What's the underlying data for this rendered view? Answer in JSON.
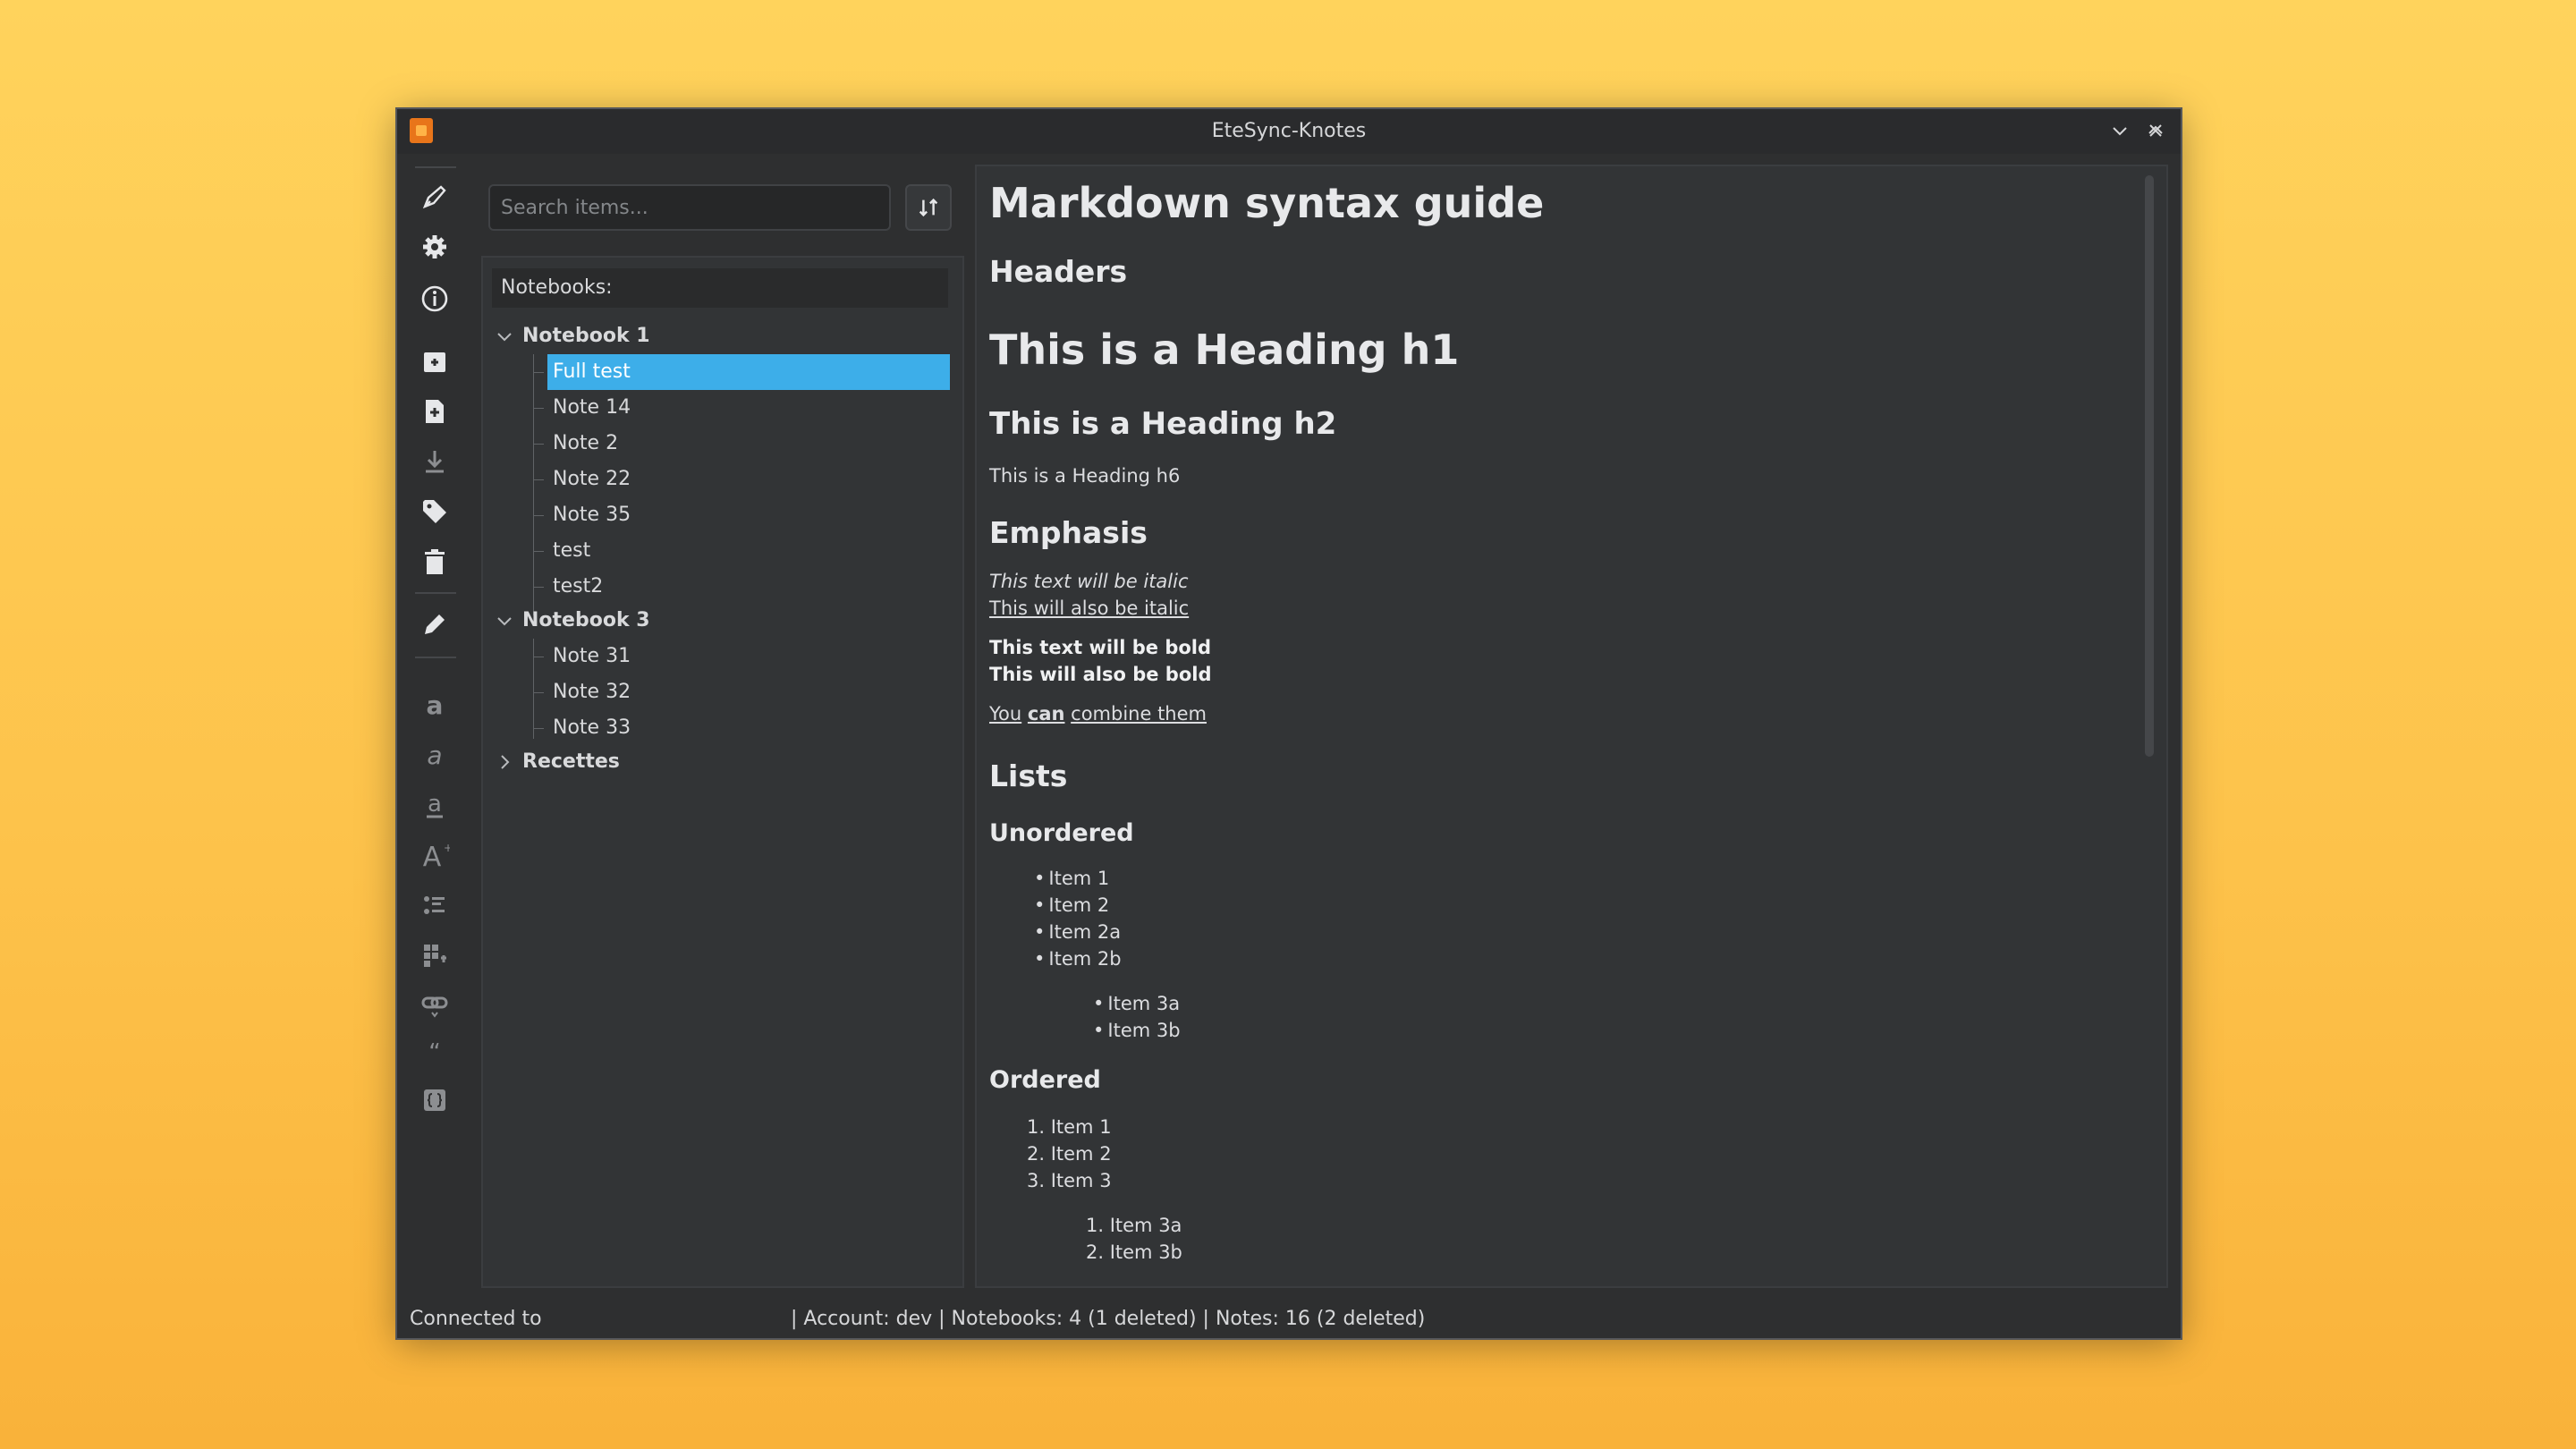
{
  "window": {
    "title": "EteSync-Knotes"
  },
  "search": {
    "placeholder": "Search items..."
  },
  "tree": {
    "header": "Notebooks:",
    "notebooks": [
      {
        "label": "Notebook 1",
        "notes": [
          "Full test",
          "Note 14",
          "Note 2",
          "Note 22",
          "Note 35",
          "test",
          "test2"
        ]
      },
      {
        "label": "Notebook 3",
        "notes": [
          "Note 31",
          "Note 32",
          "Note 33"
        ]
      },
      {
        "label": "Recettes"
      }
    ],
    "selected_note": "Full test"
  },
  "doc": {
    "title": "Markdown syntax guide",
    "headers": "Headers",
    "h1": "This is a Heading h1",
    "h2": "This is a Heading h2",
    "h6": "This is a Heading h6",
    "emphasis": "Emphasis",
    "italic1": "This text will be italic",
    "italic2": "This will also be italic",
    "bold1": "This text will be bold",
    "bold2": "This will also be bold",
    "combine_you": "You",
    "combine_can": "can",
    "combine_rest": "combine them",
    "lists": "Lists",
    "unordered": "Unordered",
    "ul": [
      "Item 1",
      "Item 2",
      "Item 2a",
      "Item 2b"
    ],
    "ul_nested": [
      "Item 3a",
      "Item 3b"
    ],
    "ordered": "Ordered",
    "ol": [
      "1. Item 1",
      "2. Item 2",
      "3. Item 3"
    ],
    "ol_nested": [
      "1. Item 3a",
      "2. Item 3b"
    ]
  },
  "status": {
    "left": "Connected to",
    "right": "| Account: dev | Notebooks: 4 (1 deleted) | Notes: 16 (2 deleted)"
  },
  "icons": {
    "toolbar": [
      "sync-icon",
      "settings-icon",
      "info-icon",
      "new-notebook-icon",
      "new-note-icon",
      "download-icon",
      "tag-icon",
      "delete-icon",
      "edit-icon",
      "bold-icon",
      "italic-icon",
      "underline-icon",
      "text-size-icon",
      "list-icon",
      "table-icon",
      "link-icon",
      "quote-icon",
      "code-icon"
    ]
  },
  "colors": {
    "accent": "#3daee9",
    "window_bg": "#2e2f30"
  }
}
